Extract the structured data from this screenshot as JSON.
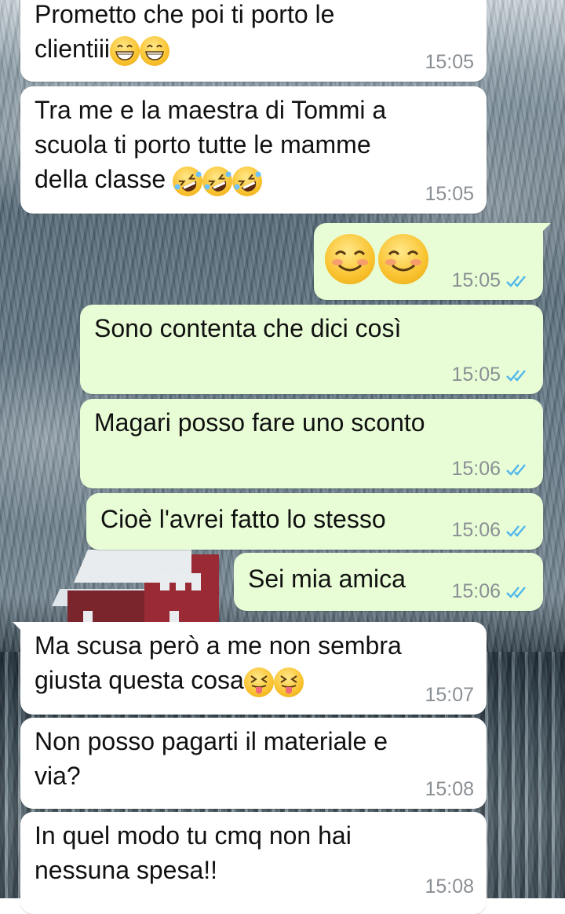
{
  "chat": {
    "messages": [
      {
        "direction": "in",
        "text": "Prometto che poi ti porto le\nclientiii",
        "emojis": [
          "grin-icon",
          "grin-icon"
        ],
        "time": "15:05"
      },
      {
        "direction": "in",
        "text": "Tra me e la maestra di Tommi a\nscuola ti porto tutte le mamme\ndella classe ",
        "emojis": [
          "rofl-icon",
          "rofl-icon",
          "rofl-icon"
        ],
        "time": "15:05"
      },
      {
        "direction": "out",
        "text": "",
        "emojis": [
          "blush-icon",
          "blush-icon"
        ],
        "time": "15:05",
        "status": "read"
      },
      {
        "direction": "out",
        "text": "Sono contenta che dici così",
        "time": "15:05",
        "status": "read"
      },
      {
        "direction": "out",
        "text": "Magari posso fare uno sconto",
        "time": "15:06",
        "status": "read"
      },
      {
        "direction": "out",
        "text": "Cioè l'avrei fatto lo stesso",
        "time": "15:06",
        "status": "read"
      },
      {
        "direction": "out",
        "text": "Sei mia amica",
        "time": "15:06",
        "status": "read"
      },
      {
        "direction": "in",
        "text": "Ma scusa però a me non sembra\ngiusta questa cosa",
        "emojis": [
          "tongue-icon",
          "tongue-icon"
        ],
        "time": "15:07"
      },
      {
        "direction": "in",
        "text": "Non posso pagarti il materiale e\nvia?",
        "time": "15:08"
      },
      {
        "direction": "in",
        "text": "In quel modo tu cmq non hai\nnessuna spesa!!",
        "time": "15:08"
      }
    ]
  },
  "colors": {
    "incoming_bubble": "#ffffff",
    "outgoing_bubble": "#e8fdd6",
    "time_text": "#8a8f94",
    "read_ticks": "#4fb6ec"
  }
}
